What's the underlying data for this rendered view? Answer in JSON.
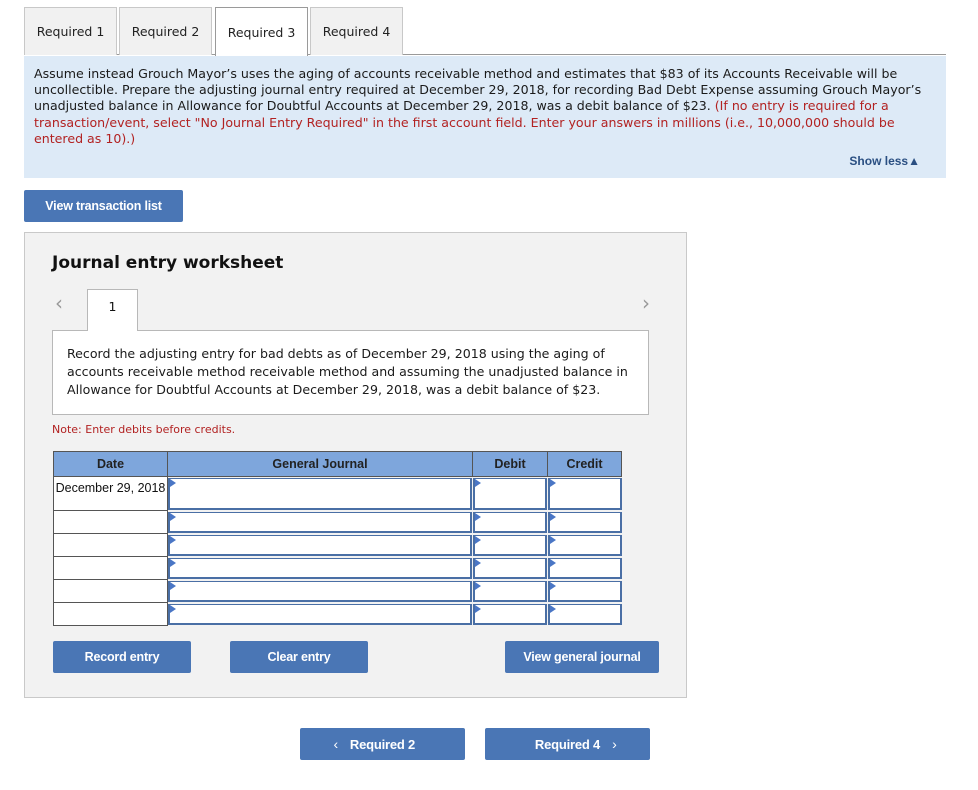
{
  "tabs": [
    {
      "label": "Required 1",
      "active": false
    },
    {
      "label": "Required 2",
      "active": false
    },
    {
      "label": "Required 3",
      "active": true
    },
    {
      "label": "Required 4",
      "active": false
    }
  ],
  "instructions": {
    "text": "Assume instead Grouch Mayor’s uses the aging of accounts receivable method and estimates that $83 of its Accounts Receivable will be uncollectible. Prepare the adjusting journal entry required at December 29, 2018, for recording Bad Debt Expense assuming Grouch Mayor’s unadjusted balance in Allowance for Doubtful Accounts at December 29, 2018, was a debit balance of $23.",
    "note_red": "(If no entry is required for a transaction/event, select \"No Journal Entry Required\" in the first account field. Enter your answers in millions (i.e., 10,000,000 should be entered as 10).)",
    "show_less_label": "Show less",
    "show_less_icon": "triangle-up-icon"
  },
  "view_transaction_list_label": "View transaction list",
  "worksheet": {
    "title": "Journal entry worksheet",
    "prev_icon": "chevron-left-icon",
    "next_icon": "chevron-right-icon",
    "entry_number": "1",
    "description": "Record the adjusting entry for bad debts as of December 29, 2018 using the aging of accounts receivable method receivable method and assuming the unadjusted balance in Allowance for Doubtful Accounts at December 29, 2018, was a debit balance of $23.",
    "note": "Note: Enter debits before credits.",
    "columns": {
      "date": "Date",
      "general_journal": "General Journal",
      "debit": "Debit",
      "credit": "Credit"
    },
    "rows": [
      {
        "date": "December 29, 2018",
        "account": "",
        "debit": "",
        "credit": ""
      },
      {
        "date": "",
        "account": "",
        "debit": "",
        "credit": ""
      },
      {
        "date": "",
        "account": "",
        "debit": "",
        "credit": ""
      },
      {
        "date": "",
        "account": "",
        "debit": "",
        "credit": ""
      },
      {
        "date": "",
        "account": "",
        "debit": "",
        "credit": ""
      },
      {
        "date": "",
        "account": "",
        "debit": "",
        "credit": ""
      }
    ],
    "record_entry_label": "Record entry",
    "clear_entry_label": "Clear entry",
    "view_general_journal_label": "View general journal"
  },
  "footer_nav": {
    "prev_label": "Required 2",
    "next_label": "Required 4"
  },
  "colors": {
    "button_blue": "#4a76b5",
    "header_blue": "#7ea6dc",
    "instruction_bg": "#ddeaf7",
    "note_red": "#b22222"
  }
}
